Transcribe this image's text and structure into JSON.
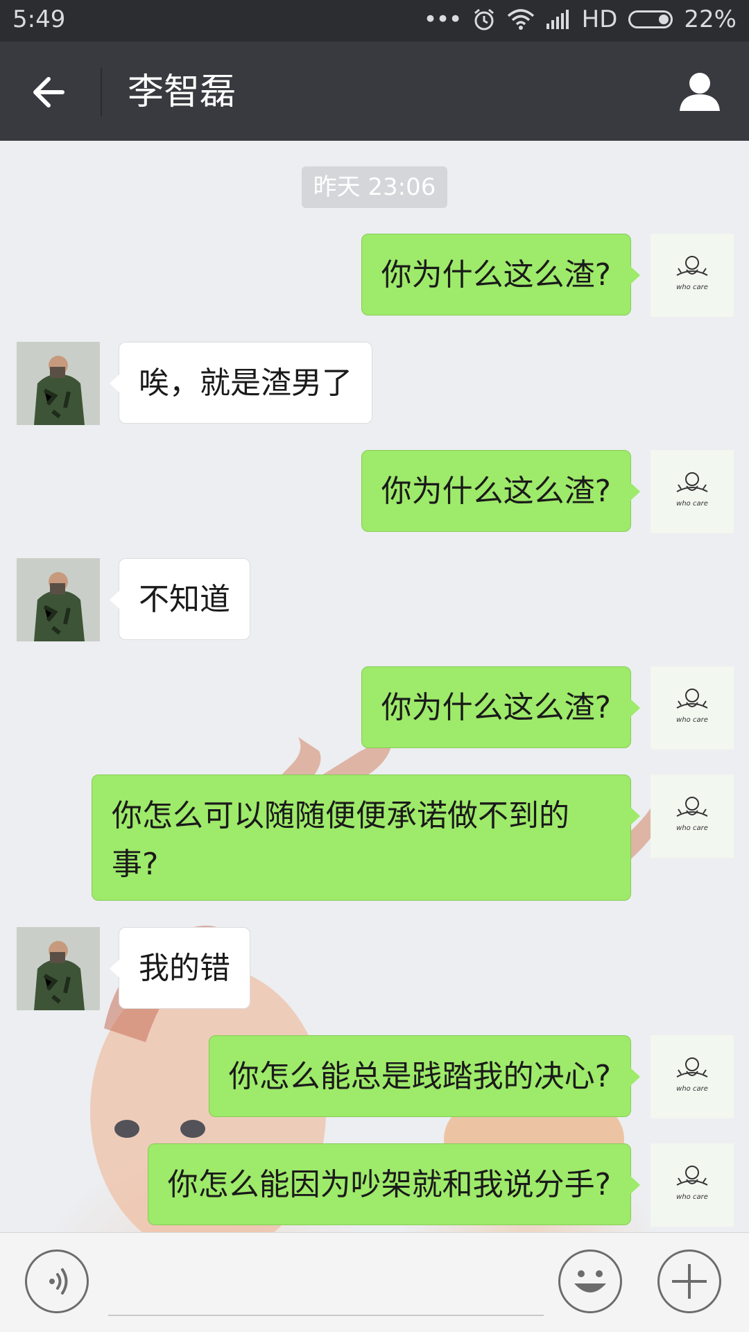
{
  "status_bar": {
    "time": "5:49",
    "network": "HD",
    "battery": "22%",
    "icons": [
      "more-dots-icon",
      "alarm-icon",
      "wifi-icon",
      "signal-icon",
      "battery-icon"
    ]
  },
  "header": {
    "title": "李智磊",
    "back_icon": "arrow-left-icon",
    "profile_icon": "person-icon"
  },
  "chat": {
    "timestamp": "昨天 23:06",
    "my_avatar_caption": "who care",
    "messages": [
      {
        "from": "me",
        "text": "你为什么这么渣?"
      },
      {
        "from": "other",
        "text": "唉，就是渣男了"
      },
      {
        "from": "me",
        "text": "你为什么这么渣?"
      },
      {
        "from": "other",
        "text": "不知道"
      },
      {
        "from": "me",
        "text": "你为什么这么渣?"
      },
      {
        "from": "me",
        "text": "你怎么可以随随便便承诺做不到的事?"
      },
      {
        "from": "other",
        "text": "我的错"
      },
      {
        "from": "me",
        "text": "你怎么能总是践踏我的决心?"
      },
      {
        "from": "me",
        "text": "你怎么能因为吵架就和我说分手?"
      }
    ]
  },
  "input_bar": {
    "voice_icon": "voice-icon",
    "emoji_icon": "emoji-icon",
    "plus_icon": "plus-icon",
    "placeholder": ""
  },
  "colors": {
    "status_bar": "#2b2d31",
    "title_bar": "#393a3f",
    "my_bubble": "#9eea6a",
    "other_bubble": "#ffffff",
    "chat_bg": "#eceef1"
  }
}
